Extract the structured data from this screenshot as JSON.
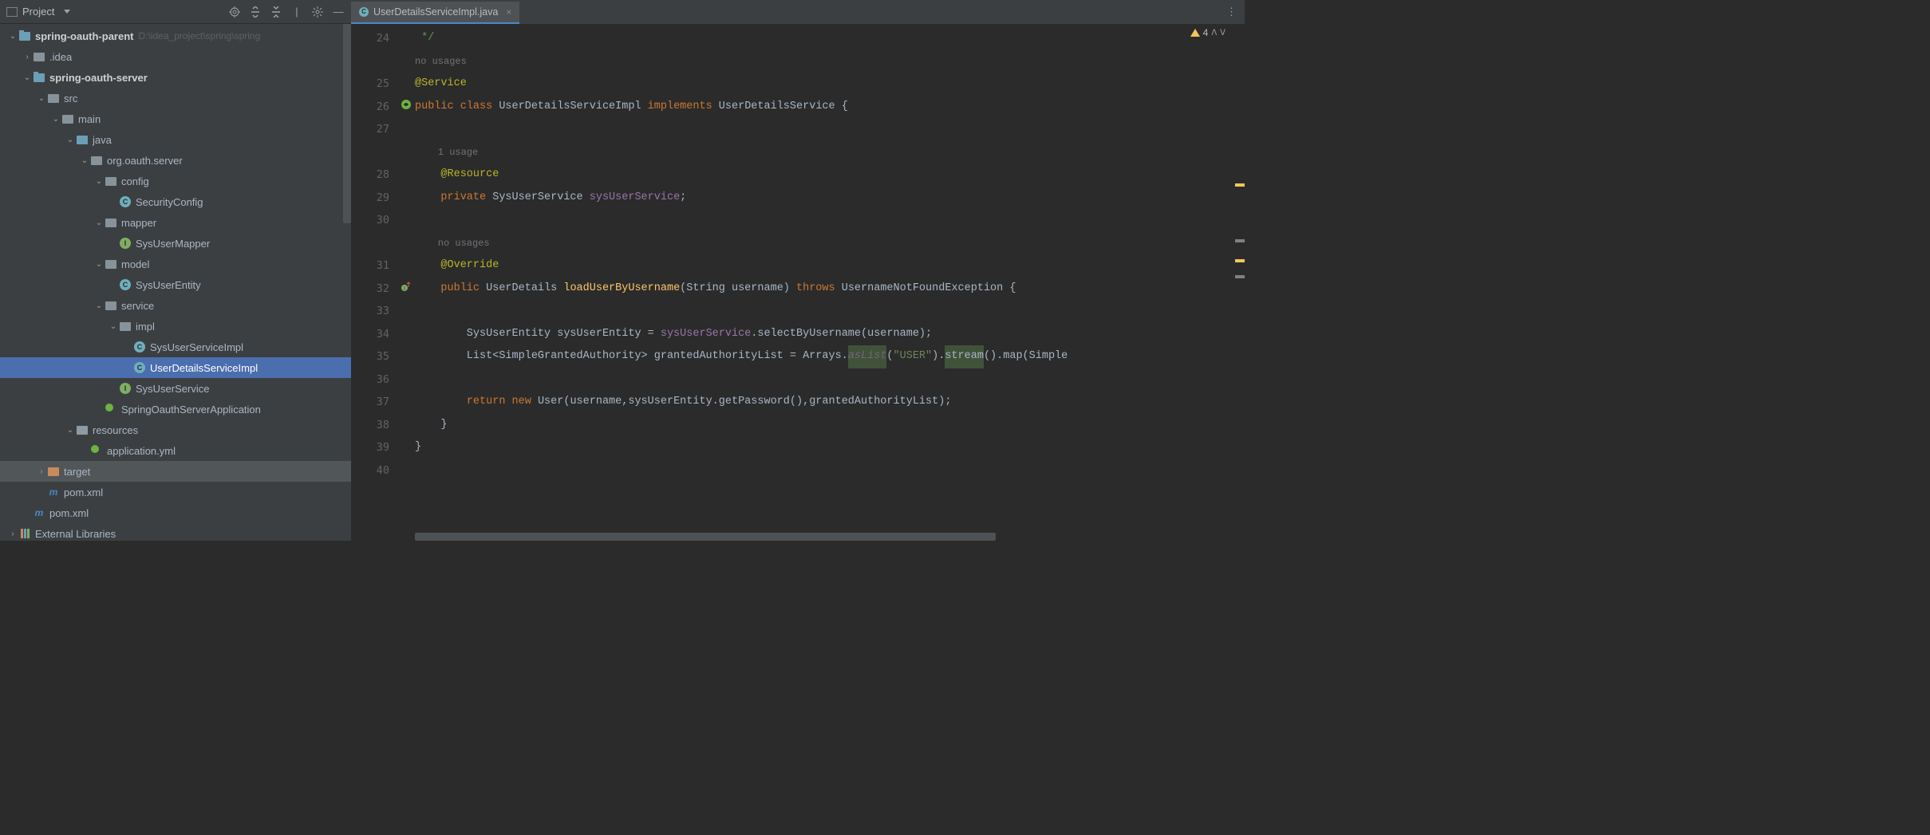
{
  "toolbar": {
    "project_label": "Project"
  },
  "tab": {
    "filename": "UserDetailsServiceImpl.java"
  },
  "tree": [
    {
      "depth": 0,
      "expand": "down",
      "icon": "module",
      "label": "spring-oauth-parent",
      "bold": true,
      "path": "D:\\idea_project\\spring\\spring"
    },
    {
      "depth": 1,
      "expand": "right",
      "icon": "folder",
      "label": ".idea"
    },
    {
      "depth": 1,
      "expand": "down",
      "icon": "module",
      "label": "spring-oauth-server",
      "bold": true
    },
    {
      "depth": 2,
      "expand": "down",
      "icon": "folder",
      "label": "src"
    },
    {
      "depth": 3,
      "expand": "down",
      "icon": "folder",
      "label": "main"
    },
    {
      "depth": 4,
      "expand": "down",
      "icon": "folder-blue",
      "label": "java"
    },
    {
      "depth": 5,
      "expand": "down",
      "icon": "package",
      "label": "org.oauth.server"
    },
    {
      "depth": 6,
      "expand": "down",
      "icon": "package",
      "label": "config"
    },
    {
      "depth": 7,
      "expand": "none",
      "icon": "class",
      "label": "SecurityConfig"
    },
    {
      "depth": 6,
      "expand": "down",
      "icon": "package",
      "label": "mapper"
    },
    {
      "depth": 7,
      "expand": "none",
      "icon": "interface",
      "label": "SysUserMapper"
    },
    {
      "depth": 6,
      "expand": "down",
      "icon": "package",
      "label": "model"
    },
    {
      "depth": 7,
      "expand": "none",
      "icon": "class",
      "label": "SysUserEntity"
    },
    {
      "depth": 6,
      "expand": "down",
      "icon": "package",
      "label": "service"
    },
    {
      "depth": 7,
      "expand": "down",
      "icon": "package",
      "label": "impl"
    },
    {
      "depth": 8,
      "expand": "none",
      "icon": "class",
      "label": "SysUserServiceImpl"
    },
    {
      "depth": 8,
      "expand": "none",
      "icon": "class",
      "label": "UserDetailsServiceImpl",
      "selected": true
    },
    {
      "depth": 7,
      "expand": "none",
      "icon": "interface",
      "label": "SysUserService"
    },
    {
      "depth": 6,
      "expand": "none",
      "icon": "spring",
      "label": "SpringOauthServerApplication"
    },
    {
      "depth": 4,
      "expand": "down",
      "icon": "folder-res",
      "label": "resources"
    },
    {
      "depth": 5,
      "expand": "none",
      "icon": "spring",
      "label": "application.yml"
    },
    {
      "depth": 2,
      "expand": "right",
      "icon": "folder-orange",
      "label": "target",
      "targetrow": true
    },
    {
      "depth": 2,
      "expand": "none",
      "icon": "maven",
      "label": "pom.xml"
    },
    {
      "depth": 1,
      "expand": "none",
      "icon": "maven",
      "label": "pom.xml"
    },
    {
      "depth": 0,
      "expand": "right",
      "icon": "lib",
      "label": "External Libraries"
    }
  ],
  "editor": {
    "warn_count": "4",
    "lines": [
      {
        "num": "24",
        "tokens": [
          {
            "t": " */",
            "c": "comment"
          }
        ]
      },
      {
        "num": "",
        "tokens": [
          {
            "t": "no usages",
            "c": "hint"
          }
        ]
      },
      {
        "num": "25",
        "tokens": [
          {
            "t": "@Service",
            "c": "ann"
          }
        ]
      },
      {
        "num": "26",
        "tokens": [
          {
            "t": "public ",
            "c": "kw"
          },
          {
            "t": "class ",
            "c": "kw"
          },
          {
            "t": "UserDetailsServiceImpl ",
            "c": "cls"
          },
          {
            "t": "implements ",
            "c": "kw"
          },
          {
            "t": "UserDetailsService {",
            "c": "cls"
          }
        ],
        "marker": "green-circle"
      },
      {
        "num": "27",
        "tokens": []
      },
      {
        "num": "",
        "tokens": [
          {
            "t": "    1 usage",
            "c": "hint"
          }
        ]
      },
      {
        "num": "28",
        "tokens": [
          {
            "t": "    @Resource",
            "c": "ann"
          }
        ]
      },
      {
        "num": "29",
        "tokens": [
          {
            "t": "    ",
            "c": ""
          },
          {
            "t": "private ",
            "c": "kw"
          },
          {
            "t": "SysUserService ",
            "c": "cls"
          },
          {
            "t": "sysUserService",
            "c": "field"
          },
          {
            "t": ";",
            "c": "cls"
          }
        ]
      },
      {
        "num": "30",
        "tokens": []
      },
      {
        "num": "",
        "tokens": [
          {
            "t": "    no usages",
            "c": "hint"
          }
        ]
      },
      {
        "num": "31",
        "tokens": [
          {
            "t": "    @Override",
            "c": "ann"
          }
        ]
      },
      {
        "num": "32",
        "tokens": [
          {
            "t": "    ",
            "c": ""
          },
          {
            "t": "public ",
            "c": "kw"
          },
          {
            "t": "UserDetails ",
            "c": "cls"
          },
          {
            "t": "loadUserByUsername",
            "c": "method"
          },
          {
            "t": "(String username) ",
            "c": "cls"
          },
          {
            "t": "throws ",
            "c": "kw"
          },
          {
            "t": "UsernameNotFoundException {",
            "c": "cls"
          }
        ],
        "marker": "override"
      },
      {
        "num": "33",
        "tokens": []
      },
      {
        "num": "34",
        "tokens": [
          {
            "t": "        SysUserEntity sysUserEntity = ",
            "c": "cls"
          },
          {
            "t": "sysUserService",
            "c": "field"
          },
          {
            "t": ".selectByUsername(username);",
            "c": "cls"
          }
        ]
      },
      {
        "num": "35",
        "tokens": [
          {
            "t": "        List<SimpleGrantedAuthority> grantedAuthorityList = Arrays.",
            "c": "cls"
          },
          {
            "t": "asList",
            "c": "italic highlight"
          },
          {
            "t": "(",
            "c": "cls"
          },
          {
            "t": "\"USER\"",
            "c": "str"
          },
          {
            "t": ").",
            "c": "cls"
          },
          {
            "t": "stream",
            "c": "cls highlight"
          },
          {
            "t": "().map(Simple",
            "c": "cls"
          }
        ]
      },
      {
        "num": "36",
        "tokens": []
      },
      {
        "num": "37",
        "tokens": [
          {
            "t": "        ",
            "c": ""
          },
          {
            "t": "return ",
            "c": "kw"
          },
          {
            "t": "new ",
            "c": "kw"
          },
          {
            "t": "User(username,sysUserEntity.getPassword(),grantedAuthorityList);",
            "c": "cls"
          }
        ]
      },
      {
        "num": "38",
        "tokens": [
          {
            "t": "    }",
            "c": "cls"
          }
        ]
      },
      {
        "num": "39",
        "tokens": [
          {
            "t": "}",
            "c": "cls"
          }
        ]
      },
      {
        "num": "40",
        "tokens": []
      }
    ]
  }
}
